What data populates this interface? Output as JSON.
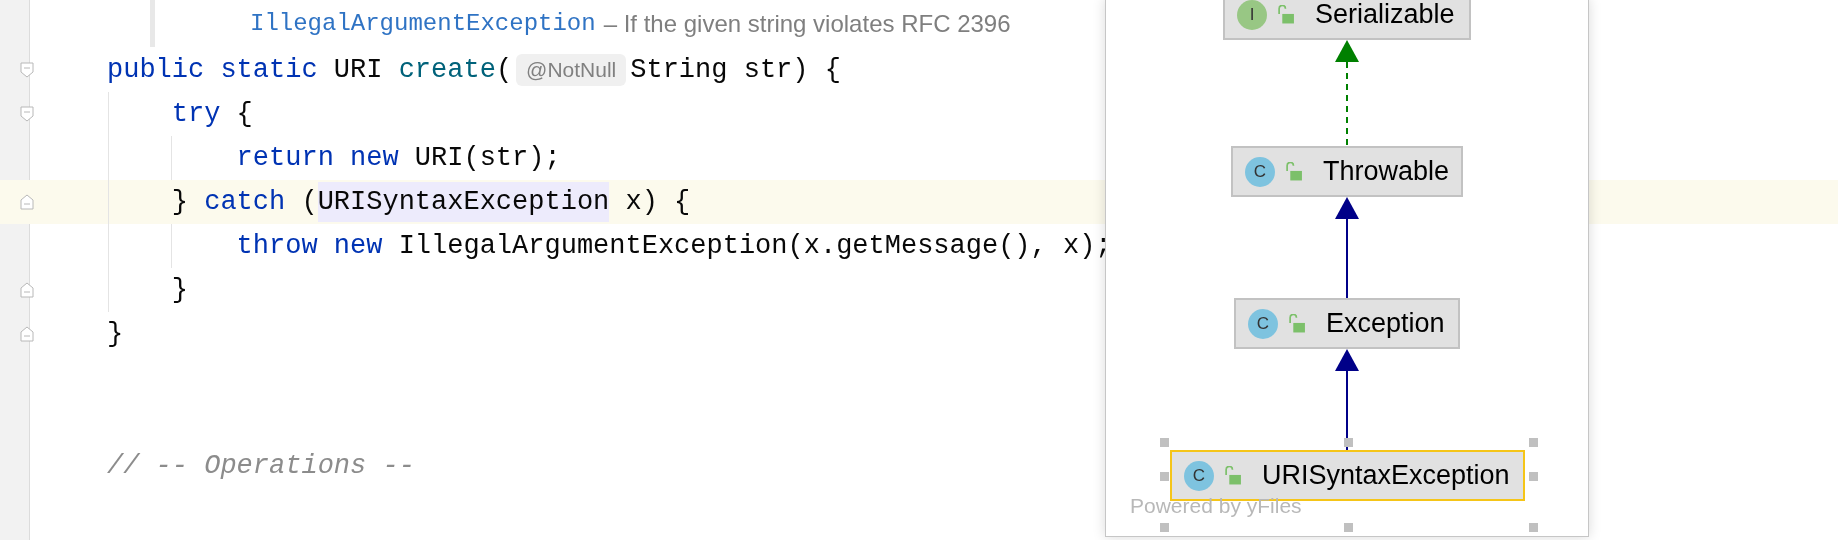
{
  "doc_line": {
    "link": "IllegalArgumentException",
    "text": "– If the given string violates RFC 2396"
  },
  "code_lines": [
    {
      "kind": "code",
      "fold": {
        "kind": "start"
      },
      "tokens": [
        {
          "kind": "keyword",
          "text": "public static"
        },
        {
          "kind": "plain",
          "text": " URI "
        },
        {
          "kind": "method",
          "text": "create"
        },
        {
          "kind": "plain",
          "text": "("
        },
        {
          "kind": "hint",
          "text": "@NotNull"
        },
        {
          "kind": "plain",
          "text": "String str) {"
        }
      ]
    },
    {
      "kind": "code",
      "fold": {
        "kind": "start"
      },
      "tokens": [
        {
          "kind": "keyword",
          "text": "    try"
        },
        {
          "kind": "plain",
          "text": " {"
        }
      ]
    },
    {
      "kind": "code",
      "tokens": [
        {
          "kind": "keyword",
          "text": "        return new"
        },
        {
          "kind": "plain",
          "text": " URI(str);"
        }
      ]
    },
    {
      "kind": "code",
      "current": true,
      "fold": {
        "kind": "end"
      },
      "tokens": [
        {
          "kind": "plain",
          "text": "    } "
        },
        {
          "kind": "keyword",
          "text": "catch"
        },
        {
          "kind": "plain",
          "text": " ("
        },
        {
          "kind": "usage",
          "text": "URISyntaxException"
        },
        {
          "kind": "plain",
          "text": " x) {"
        }
      ]
    },
    {
      "kind": "code",
      "tokens": [
        {
          "kind": "keyword",
          "text": "        throw new"
        },
        {
          "kind": "plain",
          "text": " IllegalArgumentException(x.getMessage(), x);"
        }
      ]
    },
    {
      "kind": "code",
      "fold": {
        "kind": "end"
      },
      "tokens": [
        {
          "kind": "plain",
          "text": "    }"
        }
      ]
    },
    {
      "kind": "code",
      "fold": {
        "kind": "end"
      },
      "tokens": [
        {
          "kind": "plain",
          "text": "}"
        }
      ]
    },
    {
      "kind": "blank"
    },
    {
      "kind": "blank"
    },
    {
      "kind": "code",
      "tokens": [
        {
          "kind": "comment",
          "text": "// -- Operations --"
        }
      ]
    }
  ],
  "diagram": {
    "nodes": [
      {
        "kind": "interface",
        "badge": "I",
        "name": "Serializable",
        "selected": false
      },
      {
        "kind": "class",
        "badge": "C",
        "name": "Throwable",
        "selected": false
      },
      {
        "kind": "class",
        "badge": "C",
        "name": "Exception",
        "selected": false
      },
      {
        "kind": "class",
        "badge": "C",
        "name": "URISyntaxException",
        "selected": true
      }
    ],
    "edges": [
      {
        "kind": "implements"
      },
      {
        "kind": "extends"
      },
      {
        "kind": "extends"
      }
    ],
    "footer": "Powered by yFiles"
  }
}
